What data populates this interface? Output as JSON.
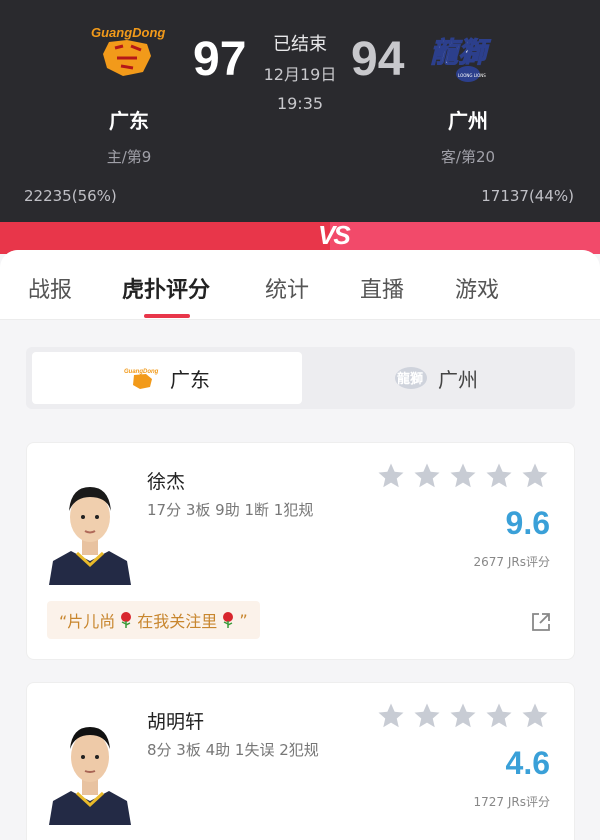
{
  "game": {
    "status": "已结束",
    "date": "12月19日",
    "time": "19:35",
    "home": {
      "name": "广东",
      "score": "97",
      "rank": "主/第9",
      "support": "22235(56%)",
      "logo_text": "GuangDong",
      "logo_icon": "guangdong-tiger-logo-icon"
    },
    "away": {
      "name": "广州",
      "score": "94",
      "rank": "客/第20",
      "support": "17137(44%)",
      "logo_text": "龍獅",
      "logo_sub": "LOONG LIONS",
      "logo_icon": "guangzhou-loong-lions-logo-icon"
    },
    "vs_label": "VS"
  },
  "tabs": [
    "战报",
    "虎扑评分",
    "统计",
    "直播",
    "游戏"
  ],
  "active_tab": 1,
  "team_switch": {
    "home_label": "广东",
    "away_label": "广州"
  },
  "players": [
    {
      "name": "徐杰",
      "stats": "17分 3板 9助 1断 1犯规",
      "rating": "9.6",
      "votes": "2677 JRs评分",
      "comment_before": "“片儿尚",
      "comment_middle": "在我关注里",
      "comment_after": "”",
      "stars_filled": 0,
      "stars_total": 5
    },
    {
      "name": "胡明轩",
      "stats": "8分 3板 4助 1失误 2犯规",
      "rating": "4.6",
      "votes": "1727 JRs评分",
      "stars_filled": 0,
      "stars_total": 5
    }
  ],
  "colors": {
    "header_bg": "#2a2a2e",
    "accent_red": "#e8364a",
    "rating_blue": "#3aa0d8",
    "star_gray": "#c8ccd4",
    "comment_text": "#c8862e",
    "comment_bg": "#fbf2ea",
    "home_logo": "#f29a1a",
    "away_logo": "#2c3f8c"
  }
}
